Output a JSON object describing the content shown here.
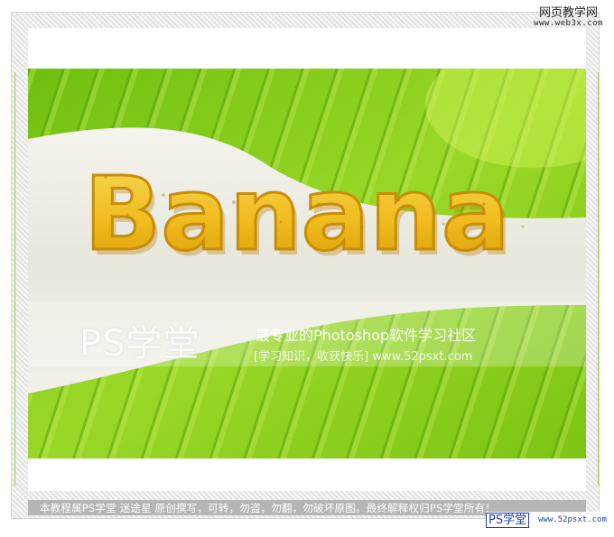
{
  "site_tag": {
    "name": "网页教学网",
    "url": "www.web3x.com"
  },
  "image": {
    "headline": "Banana",
    "colors": {
      "leaf": "#86cf1c",
      "leaf_dark": "#4c9a06",
      "band": "#eeeee6",
      "text_fill": "#f3c423",
      "text_shade": "#c98a05"
    }
  },
  "watermark": {
    "brand": "PS学堂",
    "slogan": "最专业的Photoshop软件学习社区",
    "subline": "[学习知识，收获快乐] www.52psxt.com"
  },
  "footer": {
    "notice": "本教程属PS学堂  迷途星  原创撰写，可转，勿盗，勿翻，勿破坏原图。最终解释权归PS学堂所有！",
    "logo_brand": "PS学堂",
    "logo_url": "www.52psxt.com"
  }
}
